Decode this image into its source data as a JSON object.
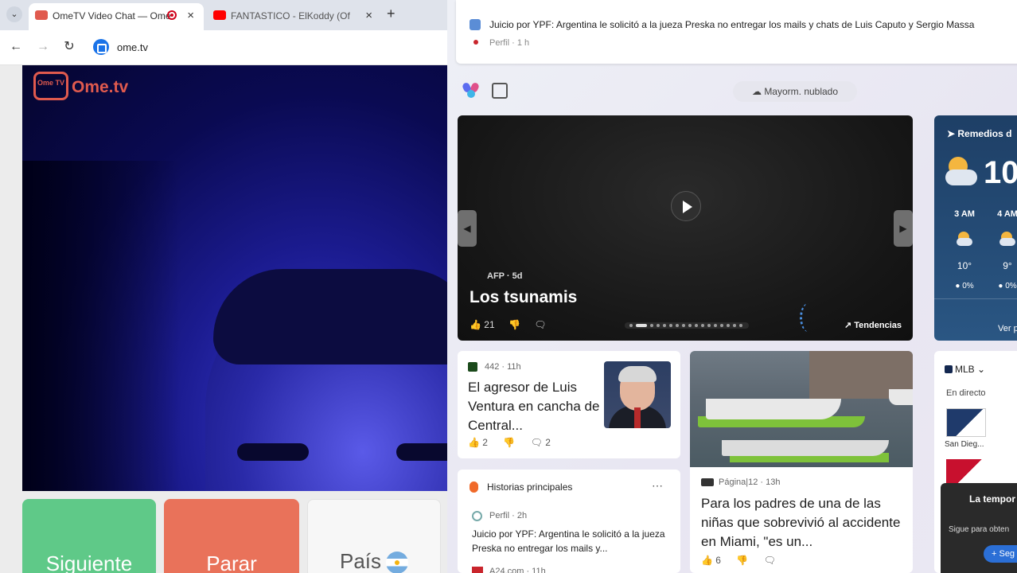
{
  "browser": {
    "tabs": [
      {
        "title": "OmeTV Video Chat — Ome",
        "active": true
      },
      {
        "title": "FANTASTICO - ElKoddy (Oficial",
        "active": false
      }
    ],
    "url": "ome.tv"
  },
  "ometv": {
    "logo_badge": "Ome TV",
    "logo_text": "Ome.tv",
    "buttons": {
      "next": "Siguiente",
      "stop": "Parar",
      "country": "País"
    }
  },
  "widgets": {
    "toast": {
      "headline": "Juicio por YPF: Argentina le solicitó a la jueza Preska no entregar los mails y chats de Luis Caputo y Sergio Massa",
      "meta": "Perfil · 1 h"
    },
    "weather_pill": "Mayorm. nublado",
    "hero": {
      "source": "AFP · 5d",
      "title": "Los tsunamis",
      "likes": "21",
      "trending": "Tendencias"
    },
    "weather": {
      "location": "Remedios d",
      "temp": "10",
      "hours": [
        {
          "time": "3 AM",
          "temp": "10°",
          "precip": "0%"
        },
        {
          "time": "4 AM",
          "temp": "9°",
          "precip": "0%"
        }
      ],
      "more": "Ver p"
    },
    "news1": {
      "source": "442 · 11h",
      "headline": "El agresor de Luis Ventura en cancha de Central...",
      "likes": "2",
      "comments": "2"
    },
    "news2": {
      "source": "Página|12 · 13h",
      "headline": "Para los padres de una de las niñas que sobrevivió al accidente en Miami, \"es un...",
      "likes": "6"
    },
    "mlb": {
      "title": "MLB",
      "live": "En directo",
      "team1": "San Dieg..."
    },
    "stories": {
      "label": "Historias principales",
      "source": "Perfil · 2h",
      "text": "Juicio por YPF: Argentina le solicitó a la jueza Preska no entregar los mails y...",
      "next_source": "A24.com · 11h"
    },
    "popup": {
      "title": "La tempor",
      "desc": "Sigue para obten",
      "button": "+ Seg"
    }
  }
}
